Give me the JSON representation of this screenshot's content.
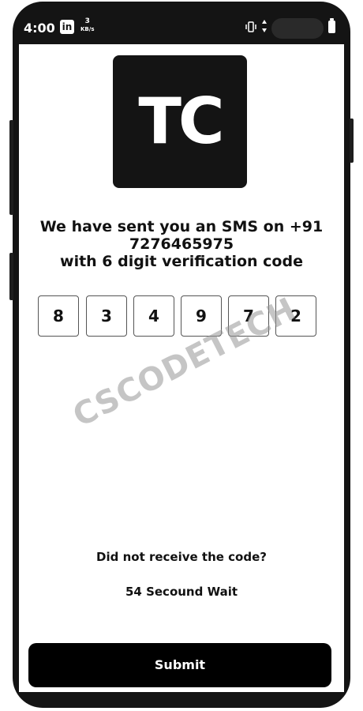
{
  "status_bar": {
    "time": "4:00",
    "app_icon": "linkedin-icon",
    "app_icon_text": "in",
    "net_speed_value": "3",
    "net_speed_unit": "KB/s"
  },
  "logo": {
    "text": "TC",
    "background": "#141414",
    "color": "#ffffff"
  },
  "message": {
    "line1": "We have sent you an SMS on +91",
    "line2": "7276465975",
    "line3": "with 6 digit verification code"
  },
  "otp": {
    "digits": [
      "8",
      "3",
      "4",
      "9",
      "7",
      "2"
    ]
  },
  "watermark": "CSCODETECH",
  "resend": {
    "prompt": "Did not receive the code?",
    "wait": "54 Secound Wait"
  },
  "submit": {
    "label": "Submit",
    "background": "#000000"
  }
}
